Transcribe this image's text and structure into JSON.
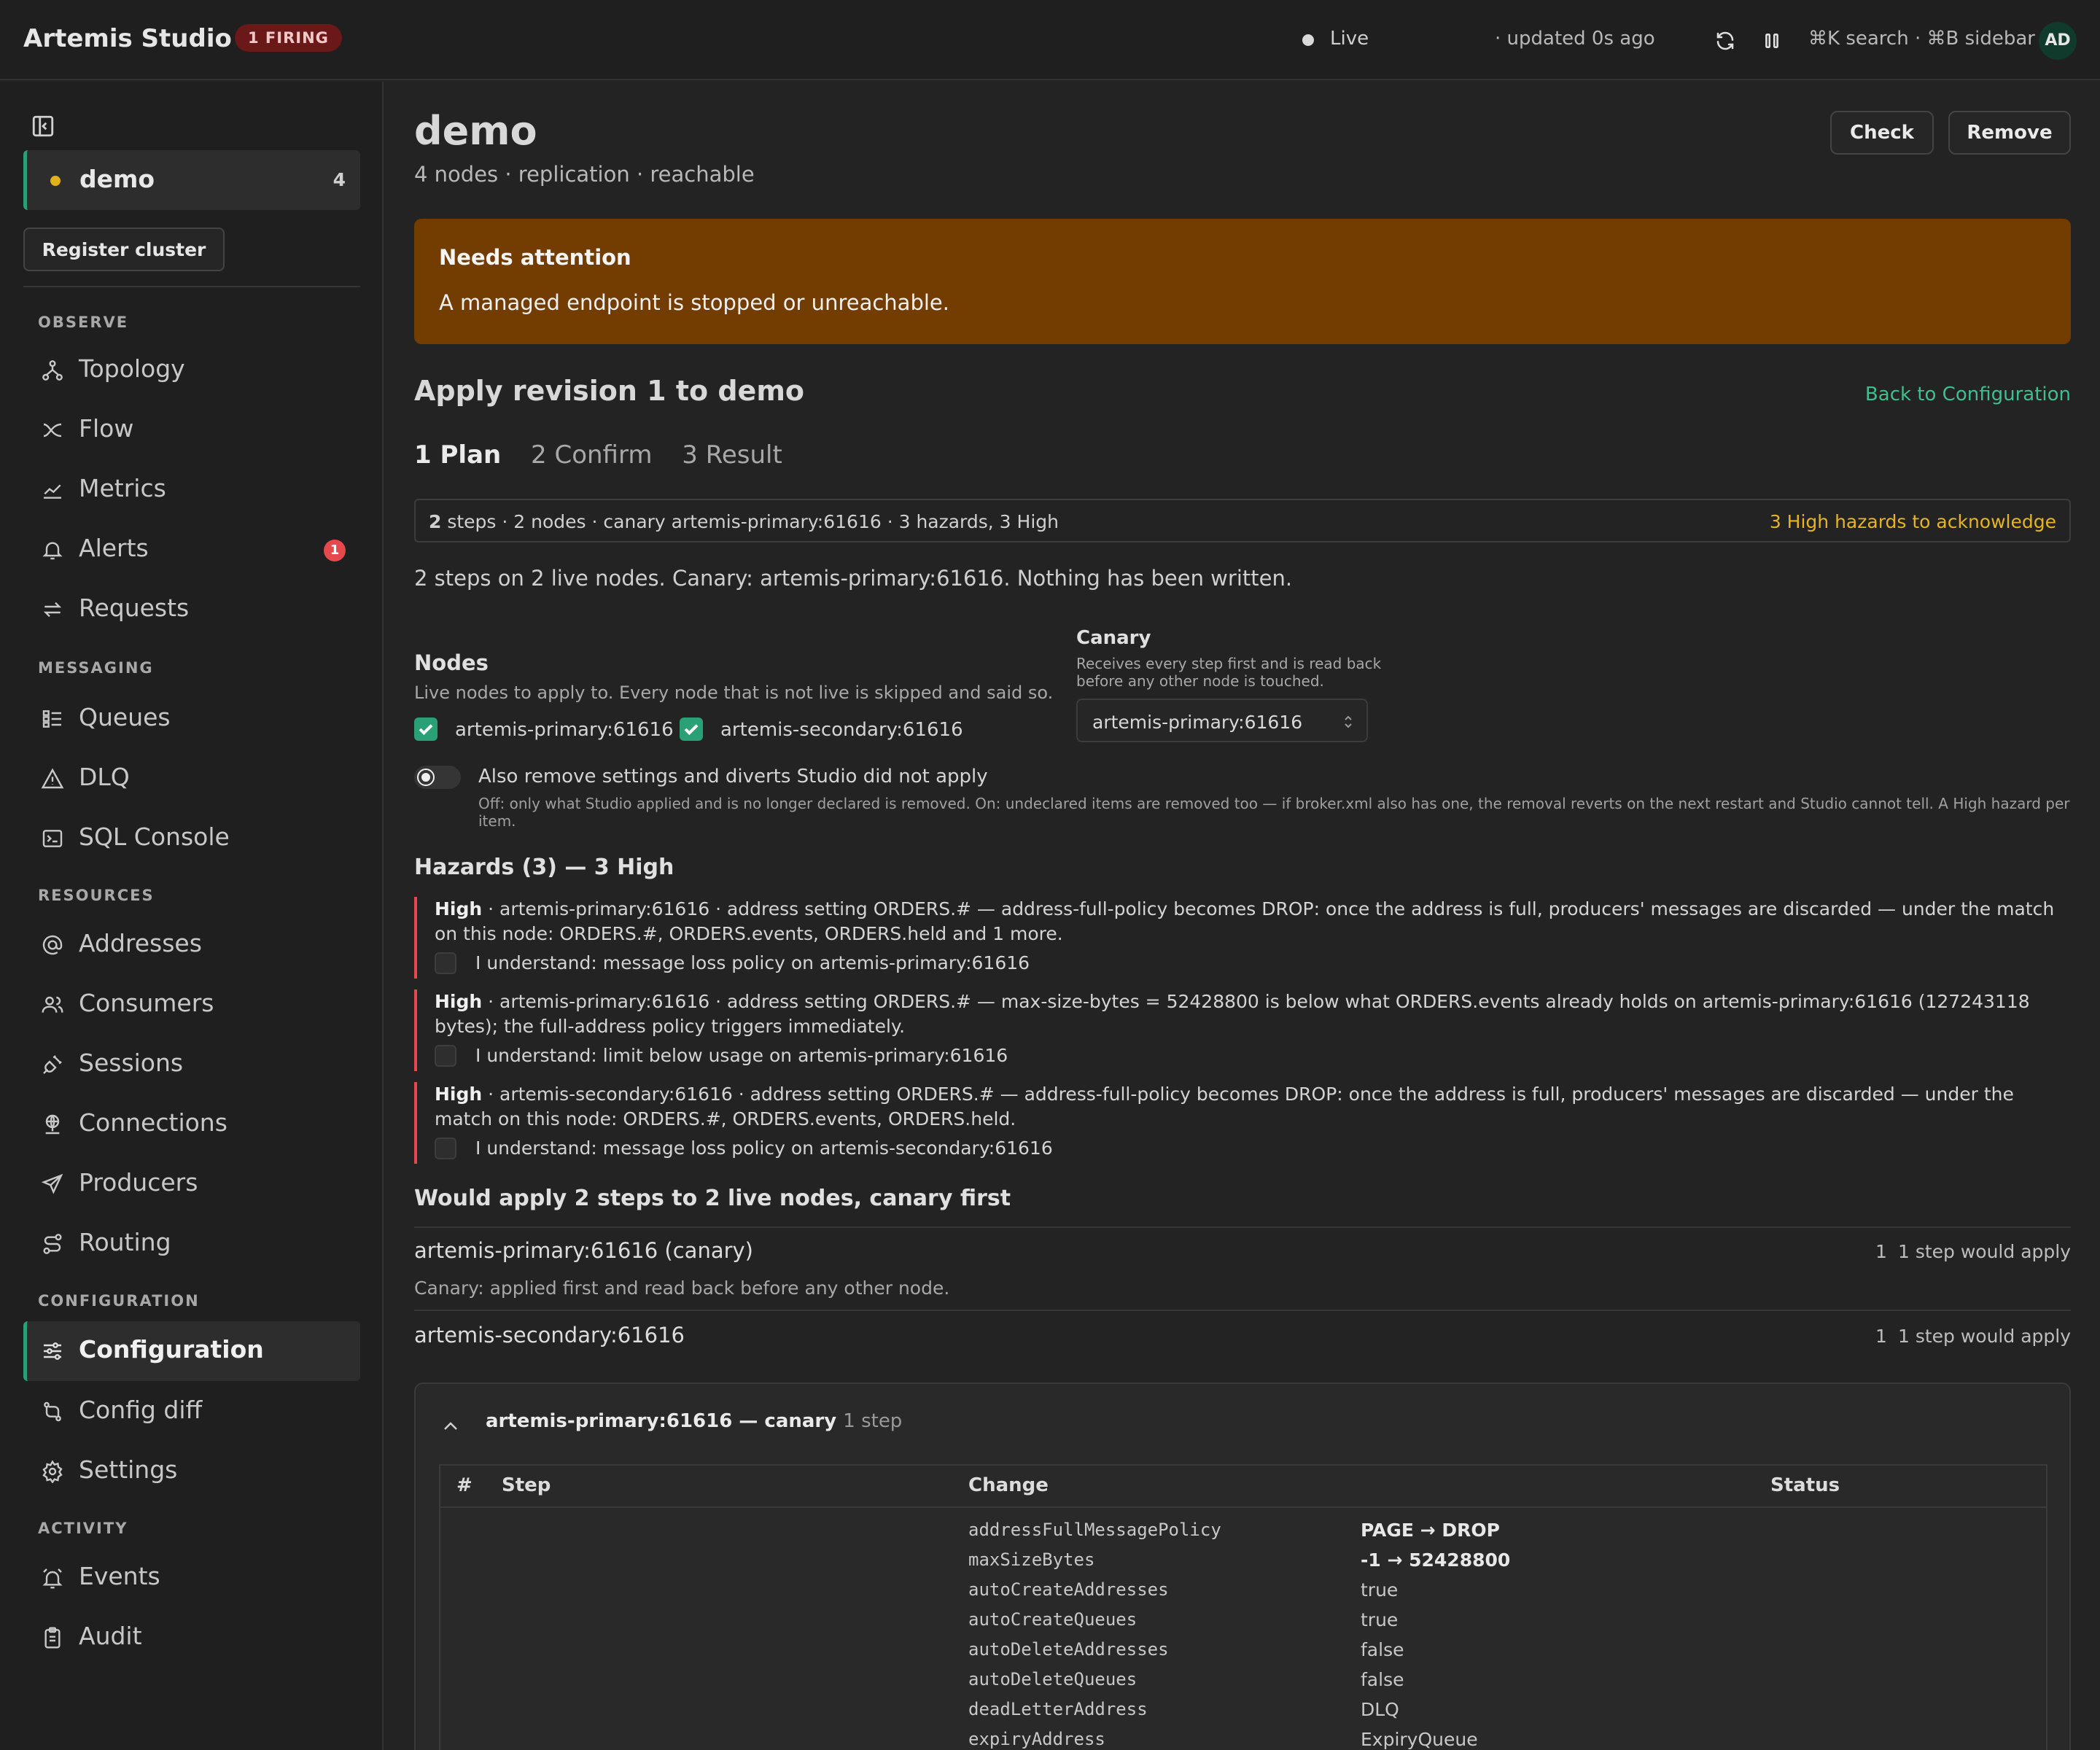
{
  "app": {
    "title": "Artemis Studio",
    "firing_badge": "1 FIRING"
  },
  "topbar": {
    "live": "Live",
    "updated": "· updated 0s ago",
    "shortcuts": "⌘K search · ⌘B sidebar",
    "avatar": "AD",
    "icons": [
      "refresh-icon",
      "pause-icon"
    ]
  },
  "sidebar": {
    "cluster": {
      "name": "demo",
      "count": "4",
      "status_color": "#e0b21a"
    },
    "register_label": "Register cluster",
    "sections": [
      {
        "label": "OBSERVE",
        "items": [
          {
            "label": "Topology",
            "icon": "topology-icon"
          },
          {
            "label": "Flow",
            "icon": "flow-icon"
          },
          {
            "label": "Metrics",
            "icon": "metrics-icon"
          },
          {
            "label": "Alerts",
            "icon": "bell-icon",
            "badge": "1"
          },
          {
            "label": "Requests",
            "icon": "arrows-icon"
          }
        ]
      },
      {
        "label": "MESSAGING",
        "items": [
          {
            "label": "Queues",
            "icon": "queues-icon"
          },
          {
            "label": "DLQ",
            "icon": "warning-icon"
          },
          {
            "label": "SQL Console",
            "icon": "terminal-icon"
          }
        ]
      },
      {
        "label": "RESOURCES",
        "items": [
          {
            "label": "Addresses",
            "icon": "at-icon"
          },
          {
            "label": "Consumers",
            "icon": "users-icon"
          },
          {
            "label": "Sessions",
            "icon": "plug-icon"
          },
          {
            "label": "Connections",
            "icon": "network-icon"
          },
          {
            "label": "Producers",
            "icon": "send-icon"
          },
          {
            "label": "Routing",
            "icon": "route-icon"
          }
        ]
      },
      {
        "label": "CONFIGURATION",
        "items": [
          {
            "label": "Configuration",
            "icon": "sliders-icon",
            "active": true
          },
          {
            "label": "Config diff",
            "icon": "diff-icon"
          },
          {
            "label": "Settings",
            "icon": "gear-icon"
          }
        ]
      },
      {
        "label": "ACTIVITY",
        "items": [
          {
            "label": "Events",
            "icon": "alarm-icon"
          },
          {
            "label": "Audit",
            "icon": "clipboard-icon"
          }
        ]
      }
    ]
  },
  "main": {
    "title": "demo",
    "subtitle": "4 nodes · replication · reachable",
    "check_label": "Check",
    "remove_label": "Remove",
    "attention": {
      "title": "Needs attention",
      "message": "A managed endpoint is stopped or unreachable."
    },
    "apply_title": "Apply revision 1 to demo",
    "back_link": "Back to Configuration",
    "steps": [
      "1 Plan",
      "2 Confirm",
      "3 Result"
    ],
    "summary": {
      "bold": "2",
      "text": " steps · 2 nodes · canary artemis-primary:61616 · 3 hazards, 3 High",
      "warning": "3 High hazards to acknowledge"
    },
    "description": "2 steps on 2 live nodes. Canary: artemis-primary:61616. Nothing has been written.",
    "nodes": {
      "title": "Nodes",
      "subtitle": "Live nodes to apply to. Every node that is not live is skipped and said so.",
      "list": [
        {
          "name": "artemis-primary:61616",
          "checked": true
        },
        {
          "name": "artemis-secondary:61616",
          "checked": true
        }
      ]
    },
    "canary": {
      "title": "Canary",
      "subtitle": "Receives every step first and is read back before any other node is touched.",
      "selected": "artemis-primary:61616"
    },
    "toggle": {
      "label": "Also remove settings and diverts Studio did not apply",
      "help": "Off: only what Studio applied and is no longer declared is removed. On: undeclared items are removed too — if broker.xml also has one, the removal reverts on the next restart and Studio cannot tell. A High hazard per item."
    },
    "hazards_title": "Hazards (3) — 3 High",
    "hazards": [
      {
        "level": "High",
        "text": " · artemis-primary:61616 · address setting ORDERS.# — address-full-policy becomes DROP: once the address is full, producers' messages are discarded — under the match on this node: ORDERS.#, ORDERS.events, ORDERS.held and 1 more.",
        "ack": "I understand: message loss policy on artemis-primary:61616"
      },
      {
        "level": "High",
        "text": " · artemis-primary:61616 · address setting ORDERS.# — max-size-bytes = 52428800 is below what ORDERS.events already holds on artemis-primary:61616 (127243118 bytes); the full-address policy triggers immediately.",
        "ack": "I understand: limit below usage on artemis-primary:61616"
      },
      {
        "level": "High",
        "text": " · artemis-secondary:61616 · address setting ORDERS.# — address-full-policy becomes DROP: once the address is full, producers' messages are discarded — under the match on this node: ORDERS.#, ORDERS.events, ORDERS.held.",
        "ack": "I understand: message loss policy on artemis-secondary:61616"
      }
    ],
    "would_apply_title": "Would apply 2 steps to 2 live nodes, canary first",
    "node_rows": [
      {
        "name": "artemis-primary:61616 (canary)",
        "count": "1",
        "steps": "1 step would apply",
        "note": "Canary: applied first and read back before any other node."
      },
      {
        "name": "artemis-secondary:61616",
        "count": "1",
        "steps": "1 step would apply"
      }
    ],
    "panel": {
      "title": "artemis-primary:61616 — canary",
      "steps": "1 step",
      "columns": [
        "#",
        "Step",
        "Change",
        "Status"
      ],
      "rows": [
        {
          "key": "addressFullMessagePolicy",
          "value": "PAGE → DROP",
          "changed": true
        },
        {
          "key": "maxSizeBytes",
          "value": "-1 → 52428800",
          "changed": true
        },
        {
          "key": "autoCreateAddresses",
          "value": "true"
        },
        {
          "key": "autoCreateQueues",
          "value": "true"
        },
        {
          "key": "autoDeleteAddresses",
          "value": "false"
        },
        {
          "key": "autoDeleteQueues",
          "value": "false"
        },
        {
          "key": "deadLetterAddress",
          "value": "DLQ"
        },
        {
          "key": "expiryAddress",
          "value": "ExpiryQueue"
        }
      ]
    }
  },
  "colors": {
    "accent": "#2aa076",
    "warning_banner": "#733c00",
    "hazard": "#e5484d",
    "highlight": "#e6b422",
    "link": "#3fbf8f"
  }
}
